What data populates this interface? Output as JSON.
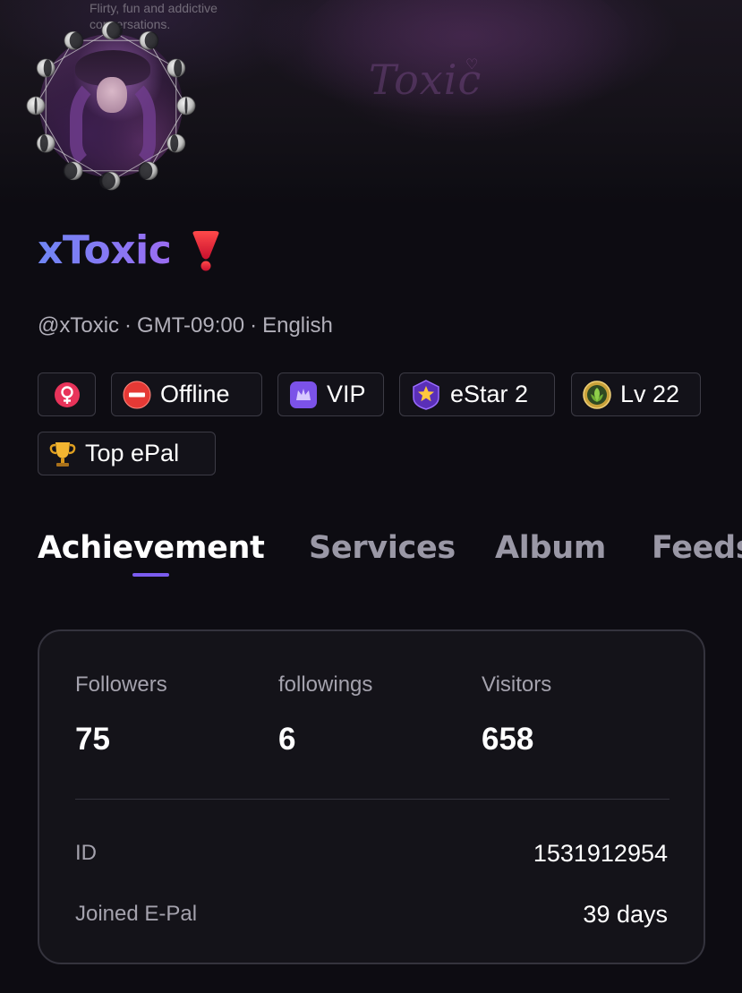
{
  "banner": {
    "tagline": "Flirty, fun and addictive conversations.",
    "watermark": "Toxic"
  },
  "profile": {
    "display_name": "xToxic",
    "name_emoji": "heavy-exclamation-icon",
    "handle": "@xToxic",
    "timezone": "GMT-09:00",
    "language": "English"
  },
  "badges": {
    "gender_icon": "female-symbol-icon",
    "status": "Offline",
    "vip": "VIP",
    "estar": "eStar 2",
    "level": "Lv 22",
    "top": "Top ePal"
  },
  "tabs": [
    {
      "label": "Achievement",
      "active": true
    },
    {
      "label": "Services",
      "active": false
    },
    {
      "label": "Album",
      "active": false
    },
    {
      "label": "Feeds",
      "active": false
    }
  ],
  "stats": {
    "followers": {
      "label": "Followers",
      "value": "75"
    },
    "followings": {
      "label": "followings",
      "value": "6"
    },
    "visitors": {
      "label": "Visitors",
      "value": "658"
    }
  },
  "info": {
    "id_label": "ID",
    "id_value": "1531912954",
    "joined_label": "Joined E-Pal",
    "joined_value": "39 days"
  },
  "colors": {
    "background": "#0d0c12",
    "name_gradient_start": "#6f86f5",
    "name_gradient_end": "#9b6cf2",
    "accent": "#7b5cf0",
    "badge_border": "#3c3b45"
  }
}
